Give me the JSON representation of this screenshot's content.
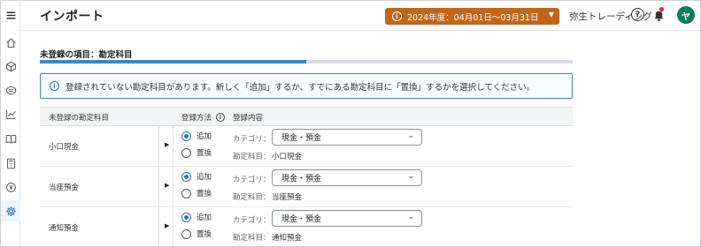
{
  "header": {
    "title": "インポート",
    "period_label": "2024年度：04月01日〜03月31日",
    "company_name": "弥生トレーディング",
    "avatar_initial": "ヤ"
  },
  "sidebar": {
    "items": [
      {
        "icon": "home-icon"
      },
      {
        "icon": "cube-icon"
      },
      {
        "icon": "transaction-icon"
      },
      {
        "icon": "chart-line-icon"
      },
      {
        "icon": "book-icon"
      },
      {
        "icon": "calculator-icon"
      },
      {
        "icon": "tax-icon"
      },
      {
        "icon": "gear-icon",
        "active": true
      }
    ]
  },
  "section": {
    "title": "未登録の項目：勘定科目",
    "progress_fraction": 0.5
  },
  "notice": {
    "text": "登録されていない勘定科目があります。新しく「追加」するか、すでにある勘定科目に「置換」するかを選択してください。"
  },
  "table": {
    "headers": {
      "unregistered": "未登録の勘定科目",
      "method": "登録方法",
      "content": "登録内容"
    },
    "category_label": "カテゴリ：",
    "account_label": "勘定科目：",
    "option_add": "追加",
    "option_replace": "置換",
    "rows": [
      {
        "name": "小口現金",
        "selected": "add",
        "category": "現金・預金",
        "account": "小口現金"
      },
      {
        "name": "当座預金",
        "selected": "add",
        "category": "現金・預金",
        "account": "当座預金"
      },
      {
        "name": "通知預金",
        "selected": "add",
        "category": "現金・預金",
        "account": "通知預金"
      }
    ]
  },
  "colors": {
    "accent": "#3c87c9",
    "period_button": "#c0661a",
    "avatar": "#0f7a5c"
  }
}
